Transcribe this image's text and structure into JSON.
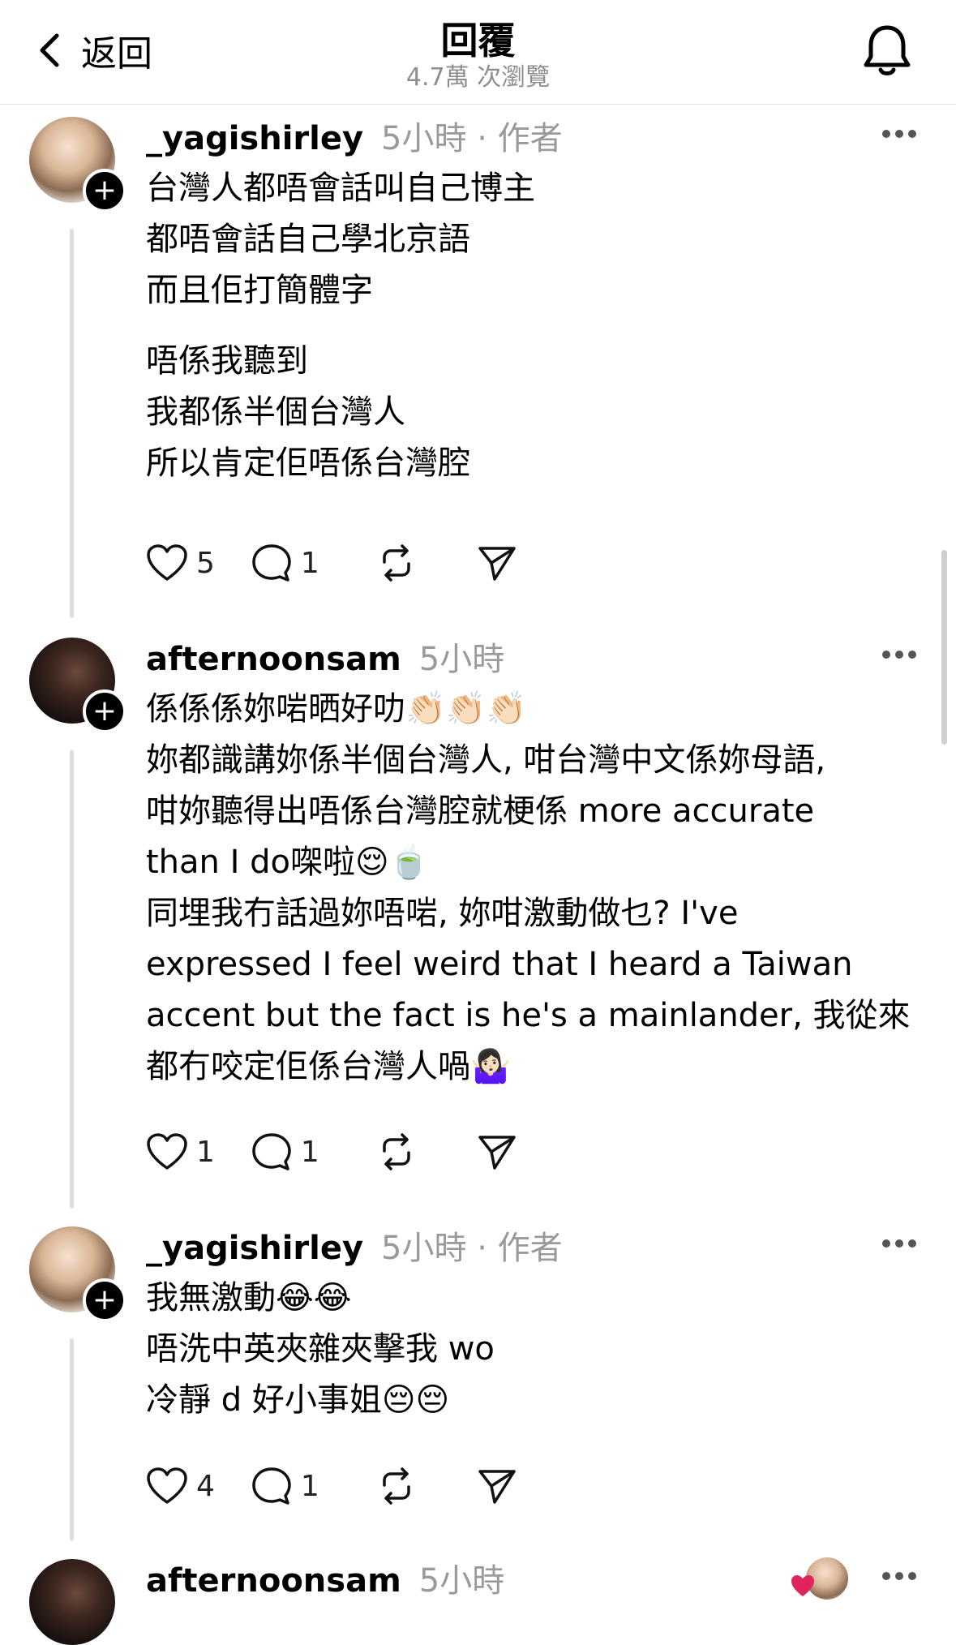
{
  "header": {
    "back_label": "返回",
    "title": "回覆",
    "views": "4.7萬 次瀏覽"
  },
  "posts": [
    {
      "username": "_yagishirley",
      "time": "5小時 · 作者",
      "lines": [
        "台灣人都唔會話叫自己博主",
        "都唔會話自己學北京語",
        "而且佢打簡體字"
      ],
      "lines2": [
        "唔係我聽到",
        "我都係半個台灣人",
        "所以肯定佢唔係台灣腔"
      ],
      "likes": "5",
      "replies": "1"
    },
    {
      "username": "afternoonsam",
      "time": "5小時",
      "lines": [
        "係係係妳啱晒好叻👏🏻👏🏻👏🏻",
        "妳都識講妳係半個台灣人, 咁台灣中文係妳母語,",
        "咁妳聽得出唔係台灣腔就梗係 more accurate",
        "than I do㗎啦😌🍵",
        "同埋我冇話過妳唔啱, 妳咁激動做乜? I've",
        "expressed I feel weird that I heard a Taiwan",
        "accent but the fact is he's a mainlander, 我從來",
        "都冇咬定佢係台灣人喎🤷🏻‍♀️"
      ],
      "likes": "1",
      "replies": "1"
    },
    {
      "username": "_yagishirley",
      "time": "5小時 · 作者",
      "lines": [
        "我無激動😂😂",
        "唔洗中英夾雜夾擊我 wo",
        "冷靜 d 好小事姐😔😔"
      ],
      "likes": "4",
      "replies": "1"
    },
    {
      "username": "afternoonsam",
      "time": "5小時"
    }
  ],
  "icons": {
    "back": "chevron-left-icon",
    "bell": "bell-icon",
    "like": "heart-icon",
    "reply": "comment-icon",
    "repost": "repost-icon",
    "share": "send-icon",
    "more": "more-icon"
  },
  "colors": {
    "muted": "#9a9a9a",
    "divider": "#dedede",
    "accent_heart": "#e0245e"
  }
}
